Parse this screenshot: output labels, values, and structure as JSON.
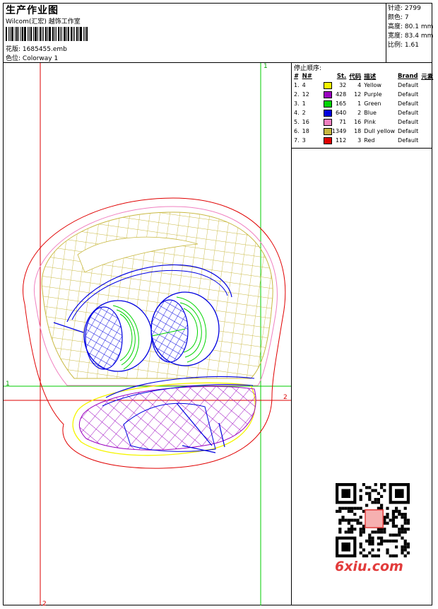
{
  "header": {
    "title": "生产作业图",
    "company": "Wilcom(汇宏) 越饰工作室",
    "design_label": "花版:",
    "design_value": "1685455.emb",
    "colorway_label": "色位:",
    "colorway_value": "Colorway 1"
  },
  "specs": [
    {
      "label": "针迹:",
      "value": "2799"
    },
    {
      "label": "颜色:",
      "value": "7"
    },
    {
      "label": "高度:",
      "value": "80.1 mm"
    },
    {
      "label": "宽度:",
      "value": "83.4 mm"
    },
    {
      "label": "比例:",
      "value": "1.61"
    }
  ],
  "stop_sequence": {
    "title": "停止顺序:",
    "headers": [
      "#",
      "N#",
      "St.",
      "代码",
      "描述",
      "Brand",
      "元素"
    ],
    "rows": [
      {
        "idx": "1.",
        "n": "4",
        "color": "#f5f500",
        "st": "32",
        "code": "4",
        "desc": "Yellow",
        "brand": "Default"
      },
      {
        "idx": "2.",
        "n": "12",
        "color": "#9a00c0",
        "st": "428",
        "code": "12",
        "desc": "Purple",
        "brand": "Default"
      },
      {
        "idx": "3.",
        "n": "1",
        "color": "#00d400",
        "st": "165",
        "code": "1",
        "desc": "Green",
        "brand": "Default"
      },
      {
        "idx": "4.",
        "n": "2",
        "color": "#0000e0",
        "st": "640",
        "code": "2",
        "desc": "Blue",
        "brand": "Default"
      },
      {
        "idx": "5.",
        "n": "16",
        "color": "#f080c0",
        "st": "71",
        "code": "16",
        "desc": "Pink",
        "brand": "Default"
      },
      {
        "idx": "6.",
        "n": "18",
        "color": "#c8b840",
        "st": "1349",
        "code": "18",
        "desc": "Dull yellow",
        "brand": "Default"
      },
      {
        "idx": "7.",
        "n": "3",
        "color": "#e00000",
        "st": "112",
        "code": "3",
        "desc": "Red",
        "brand": "Default"
      }
    ]
  },
  "guides": {
    "top_label": "1",
    "left_label": "1",
    "right_label": "2",
    "bottom_label": "2"
  },
  "watermark": {
    "site": "6xiu.com"
  },
  "colors": {
    "guide_green": "#00cc00",
    "guide_red": "#dd0000",
    "dull_yellow": "#c8b840",
    "purple": "#9a00c0",
    "blue": "#0000e0",
    "green": "#00d400",
    "pink": "#f080c0",
    "yellow": "#f5f500",
    "red": "#e00000"
  }
}
